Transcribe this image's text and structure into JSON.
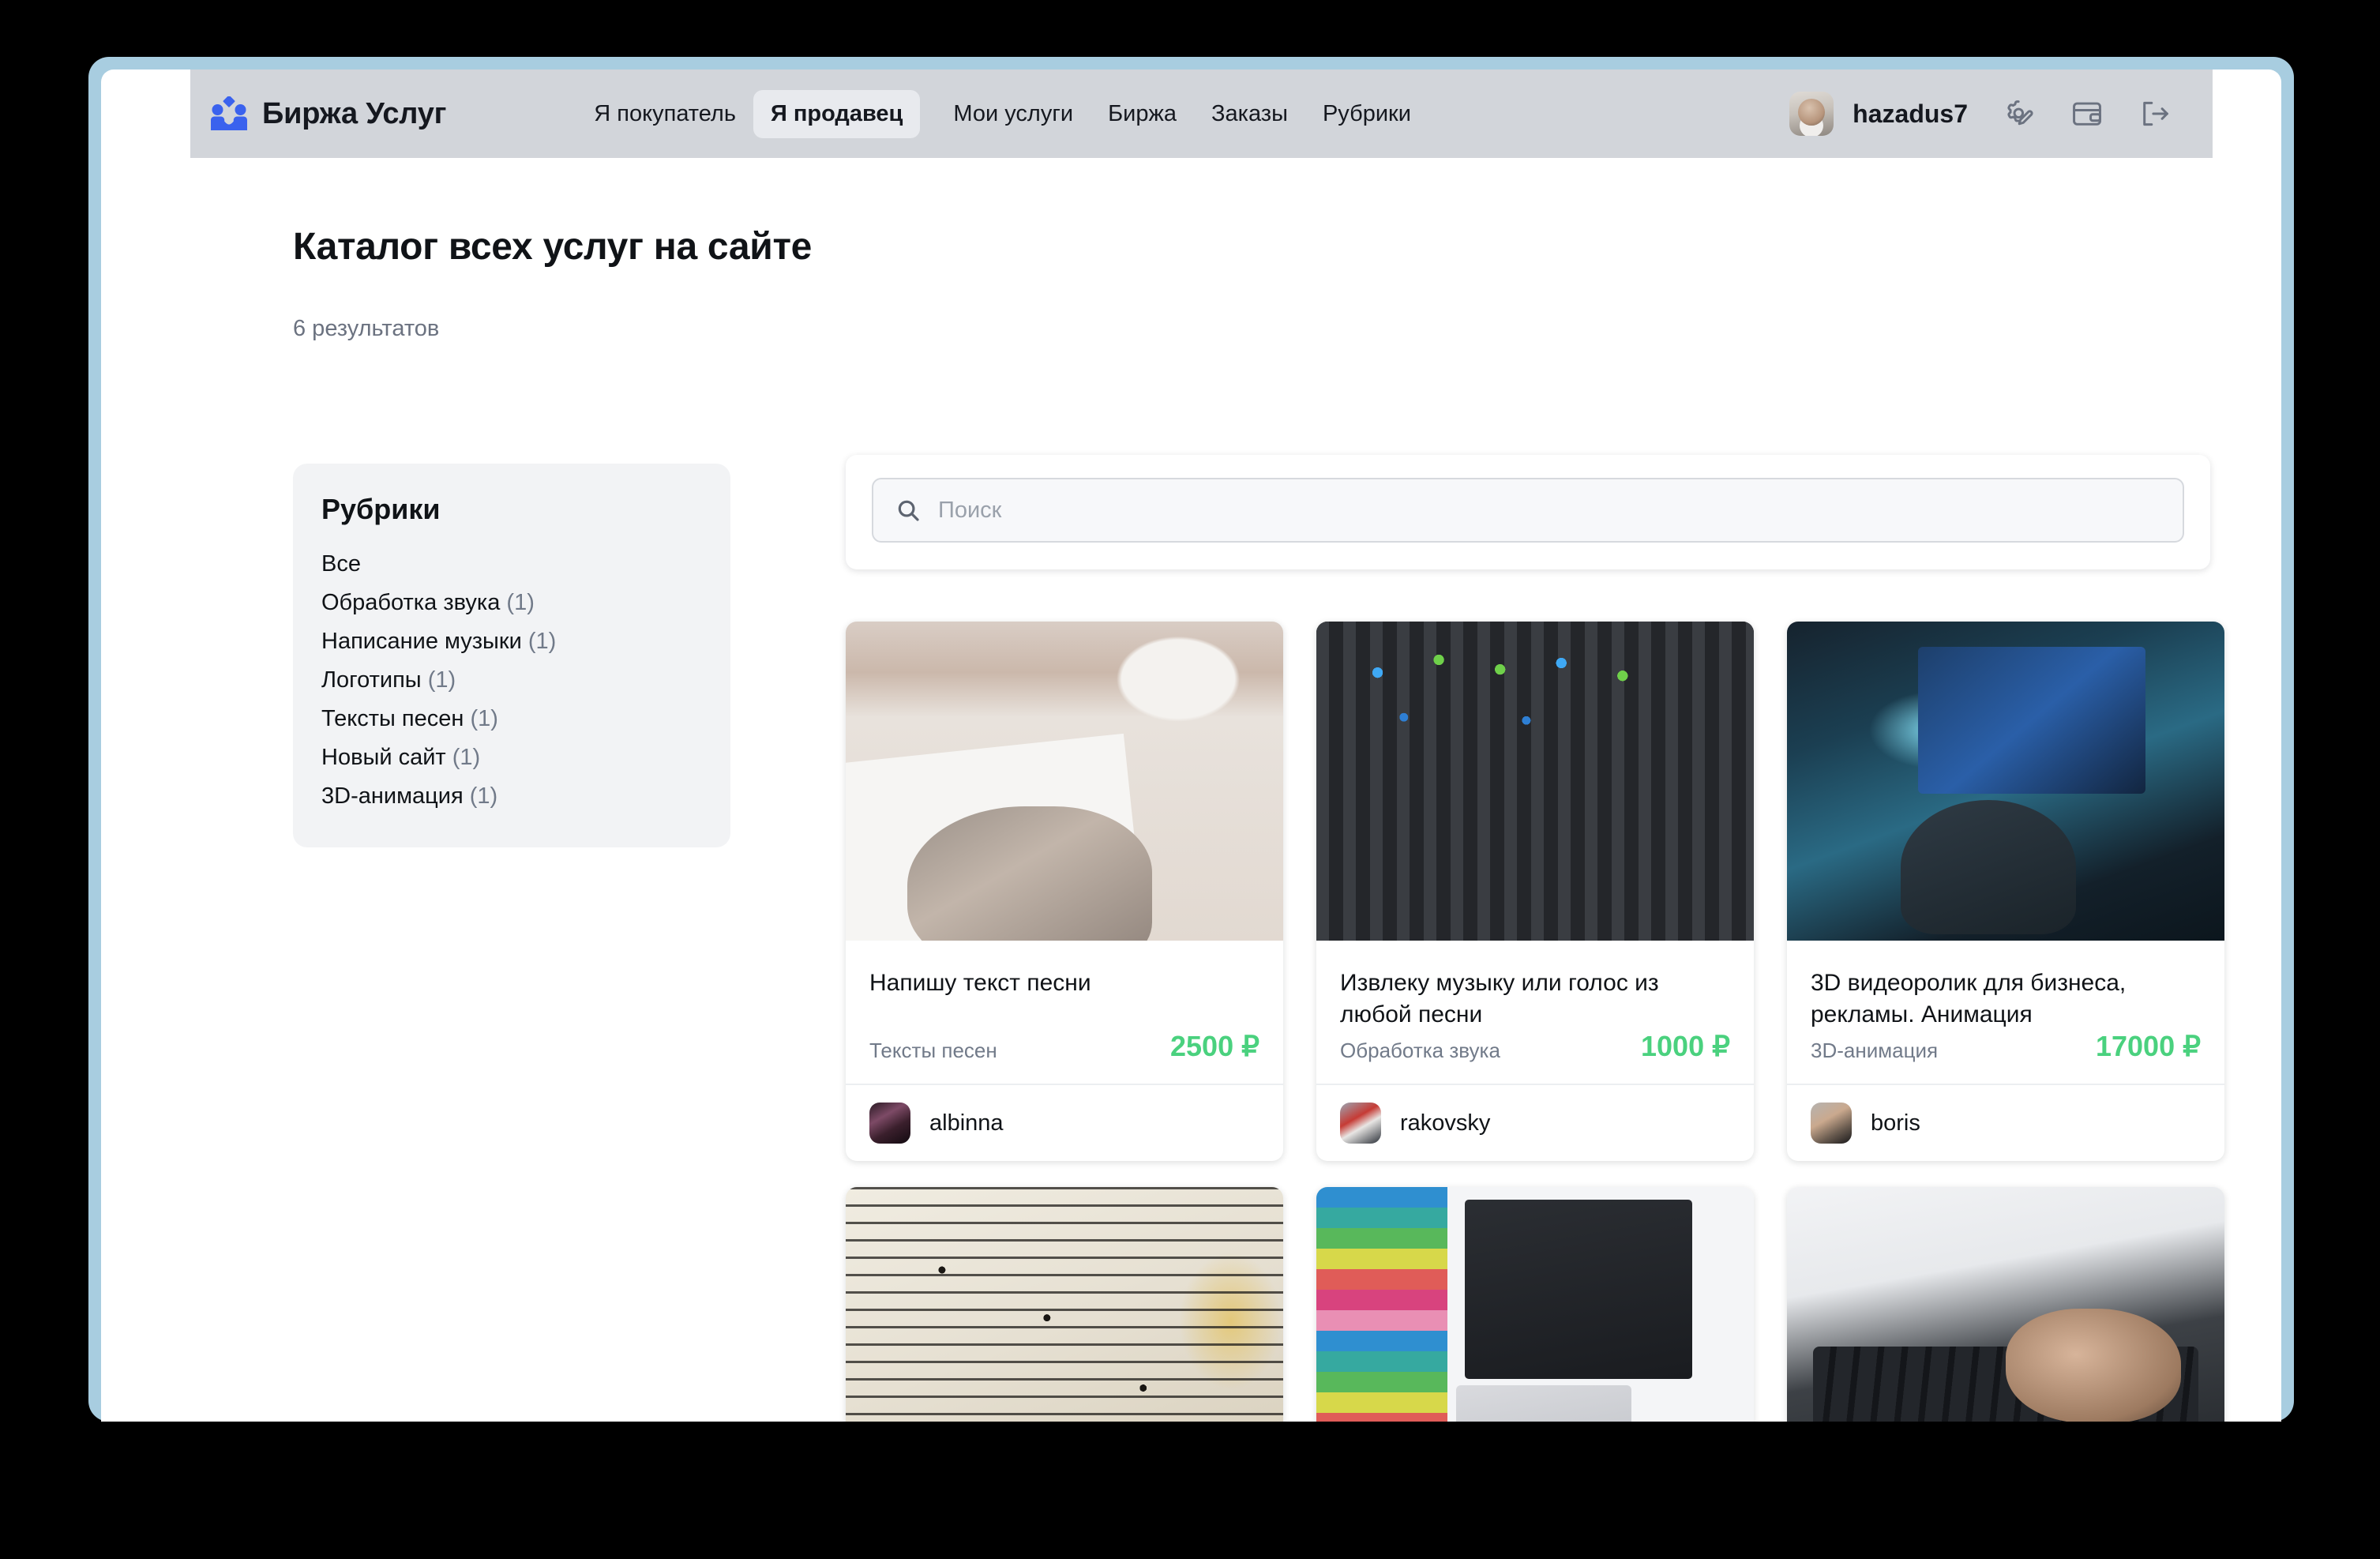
{
  "header": {
    "brand_name": "Биржа Услуг",
    "logo_icon": "handshake-people-icon",
    "nav": [
      {
        "label": "Я покупатель",
        "active": false
      },
      {
        "label": "Я продавец",
        "active": true
      },
      {
        "label": "Мои услуги",
        "active": false
      },
      {
        "label": "Биржа",
        "active": false
      },
      {
        "label": "Заказы",
        "active": false
      },
      {
        "label": "Рубрики",
        "active": false
      }
    ],
    "username": "hazadus7",
    "icons": [
      "settings-gear-edit-icon",
      "wallet-icon",
      "logout-icon"
    ],
    "background_color": "#d2d5da"
  },
  "page": {
    "title": "Каталог всех услуг на сайте",
    "results_count": "6 результатов"
  },
  "sidebar": {
    "title": "Рубрики",
    "items": [
      {
        "label": "Все",
        "count": ""
      },
      {
        "label": "Обработка звука",
        "count": "(1)"
      },
      {
        "label": "Написание музыки",
        "count": "(1)"
      },
      {
        "label": "Логотипы",
        "count": "(1)"
      },
      {
        "label": "Тексты песен",
        "count": "(1)"
      },
      {
        "label": "Новый сайт",
        "count": "(1)"
      },
      {
        "label": "3D-анимация",
        "count": "(1)"
      }
    ]
  },
  "search": {
    "placeholder": "Поиск",
    "value": "",
    "icon": "search-icon"
  },
  "cards": [
    {
      "title": "Напишу текст песни",
      "category": "Тексты песен",
      "price": "2500 ₽",
      "author": "albinna",
      "thumb": "person-writing-with-pen-at-desk"
    },
    {
      "title": "Извлеку музыку или голос из любой песни",
      "category": "Обработка звука",
      "price": "1000 ₽",
      "author": "rakovsky",
      "thumb": "audio-mixing-console"
    },
    {
      "title": "3D видеоролик для бизнеса, рекламы. Анимация",
      "category": "3D-анимация",
      "price": "17000 ₽",
      "author": "boris",
      "thumb": "designer-at-dual-monitor-workstation"
    },
    {
      "title": "",
      "category": "",
      "price": "",
      "author": "",
      "thumb": "vintage-sheet-music-score"
    },
    {
      "title": "",
      "category": "",
      "price": "",
      "author": "",
      "thumb": "color-swatches-laptop-graphics-tablet"
    },
    {
      "title": "",
      "category": "",
      "price": "",
      "author": "",
      "thumb": "hands-typing-on-laptop-keyboard"
    }
  ],
  "colors": {
    "accent_blue": "#3a62ee",
    "price_green": "#4ad17e",
    "header_gray": "#d2d5da",
    "sidebar_gray": "#f2f3f5",
    "window_border": "#a8cde0",
    "muted_text": "#717a89"
  }
}
